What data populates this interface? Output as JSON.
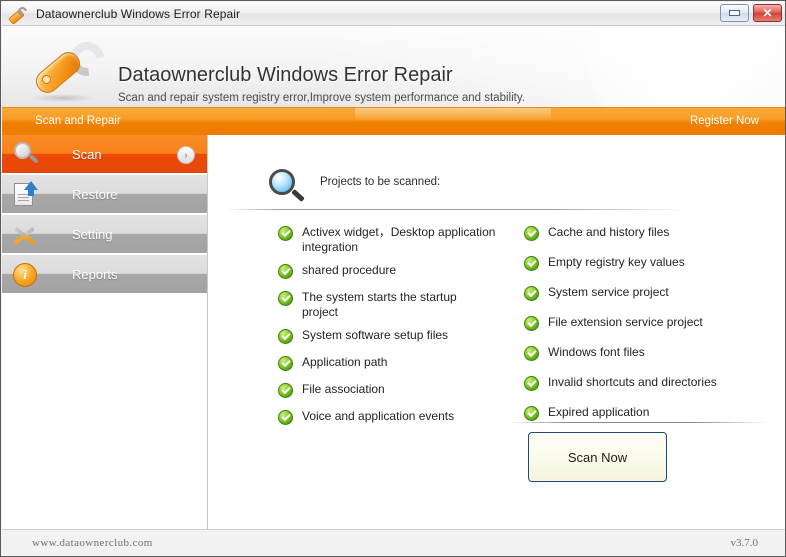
{
  "window": {
    "title": "Dataownerclub Windows Error Repair",
    "title_icon": "wrench-icon",
    "minimize_label": "",
    "close_label": "✕"
  },
  "header": {
    "logo_icon": "wrench-logo-icon",
    "title": "Dataownerclub Windows Error Repair",
    "subtitle": "Scan and repair system registry error,Improve system performance and stability."
  },
  "navbar": {
    "section_label": "Scan and Repair",
    "register_label": "Register Now",
    "accent_color": "#f08000"
  },
  "sidebar": {
    "items": [
      {
        "label": "Scan",
        "icon": "magnifier-icon",
        "active": true,
        "arrow": "›"
      },
      {
        "label": "Restore",
        "icon": "restore-icon",
        "active": false,
        "arrow": ""
      },
      {
        "label": "Setting",
        "icon": "tools-icon",
        "active": false,
        "arrow": ""
      },
      {
        "label": "Reports",
        "icon": "info-icon",
        "active": false,
        "arrow": ""
      }
    ]
  },
  "main": {
    "panel_icon": "blue-magnifier-icon",
    "panel_heading": "Projects to be scanned:",
    "left_items": [
      "Activex widget，Desktop application integration",
      "shared procedure",
      "The system starts the startup project",
      "System software setup files",
      "Application path",
      "File association",
      "Voice and application events"
    ],
    "right_items": [
      "Cache and history files",
      "Empty registry key values",
      "System service project",
      "File extension service project",
      "Windows font files",
      "Invalid shortcuts and directories",
      "Expired application"
    ],
    "scan_button_label": "Scan Now"
  },
  "footer": {
    "website": "www.dataownerclub.com",
    "version": "v3.7.0"
  }
}
